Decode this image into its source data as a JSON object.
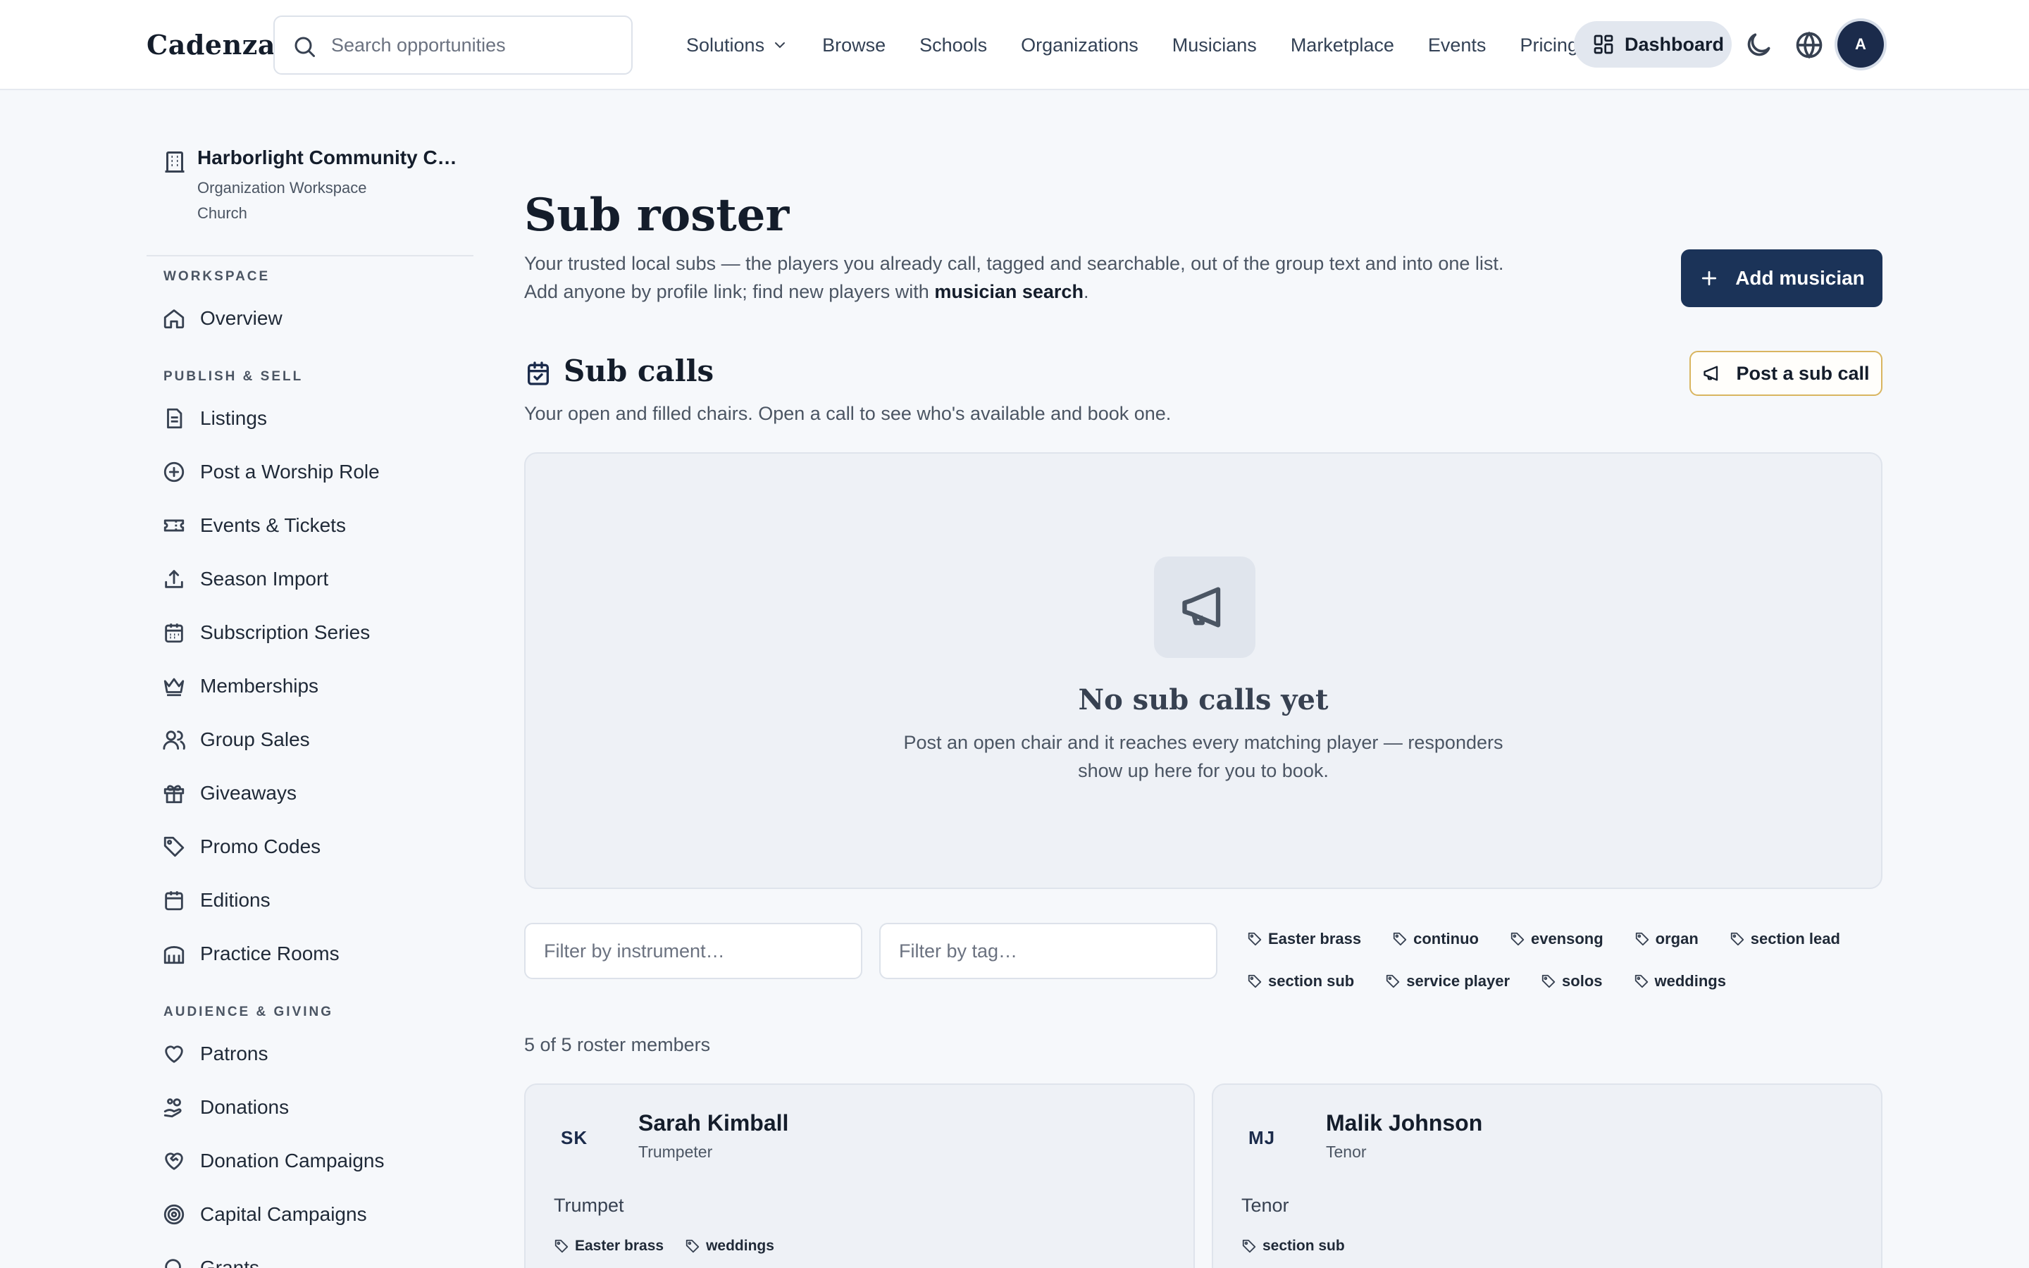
{
  "app": {
    "brand": "Cadenza"
  },
  "search": {
    "placeholder": "Search opportunities"
  },
  "nav": {
    "solutions": "Solutions",
    "links": [
      "Browse",
      "Schools",
      "Organizations",
      "Musicians",
      "Marketplace",
      "Events",
      "Pricing"
    ],
    "dashboard": "Dashboard",
    "avatar_initial": "A"
  },
  "sidebar": {
    "org_name": "Harborlight Community Church",
    "org_type": "Organization Workspace",
    "org_category": "Church",
    "sections": {
      "workspace": "WORKSPACE",
      "publish": "PUBLISH & SELL",
      "audience": "AUDIENCE & GIVING"
    },
    "items": {
      "overview": "Overview",
      "listings": "Listings",
      "post_worship_role": "Post a Worship Role",
      "events_tickets": "Events & Tickets",
      "season_import": "Season Import",
      "subscription_series": "Subscription Series",
      "memberships": "Memberships",
      "group_sales": "Group Sales",
      "giveaways": "Giveaways",
      "promo_codes": "Promo Codes",
      "editions": "Editions",
      "practice_rooms": "Practice Rooms",
      "patrons": "Patrons",
      "donations": "Donations",
      "donation_campaigns": "Donation Campaigns",
      "capital_campaigns": "Capital Campaigns",
      "grants": "Grants"
    }
  },
  "main": {
    "title": "Sub roster",
    "desc_line1": "Your trusted local subs — the players you already call, tagged and searchable, out of the group text and into one list.",
    "desc_line2_prefix": "Add anyone by profile link; find new players with ",
    "desc_link": "musician search",
    "desc_line2_suffix": ".",
    "add_button": "Add musician",
    "calls_title": "Sub calls",
    "calls_desc": "Your open and filled chairs. Open a call to see who's available and book one.",
    "post_button": "Post a sub call",
    "empty_title": "No sub calls yet",
    "empty_desc": "Post an open chair and it reaches every matching player — responders show up here for you to book.",
    "filter_instrument_placeholder": "Filter by instrument…",
    "filter_tag_placeholder": "Filter by tag…",
    "tags": [
      "Easter brass",
      "continuo",
      "evensong",
      "organ",
      "section lead",
      "section sub",
      "service player",
      "solos",
      "weddings"
    ],
    "count": "5 of 5 roster members",
    "members": [
      {
        "initials": "SK",
        "name": "Sarah Kimball",
        "role": "Trumpeter",
        "instrument": "Trumpet",
        "tags": [
          "Easter brass",
          "weddings"
        ]
      },
      {
        "initials": "MJ",
        "name": "Malik Johnson",
        "role": "Tenor",
        "instrument": "Tenor",
        "tags": [
          "section sub"
        ]
      }
    ]
  }
}
